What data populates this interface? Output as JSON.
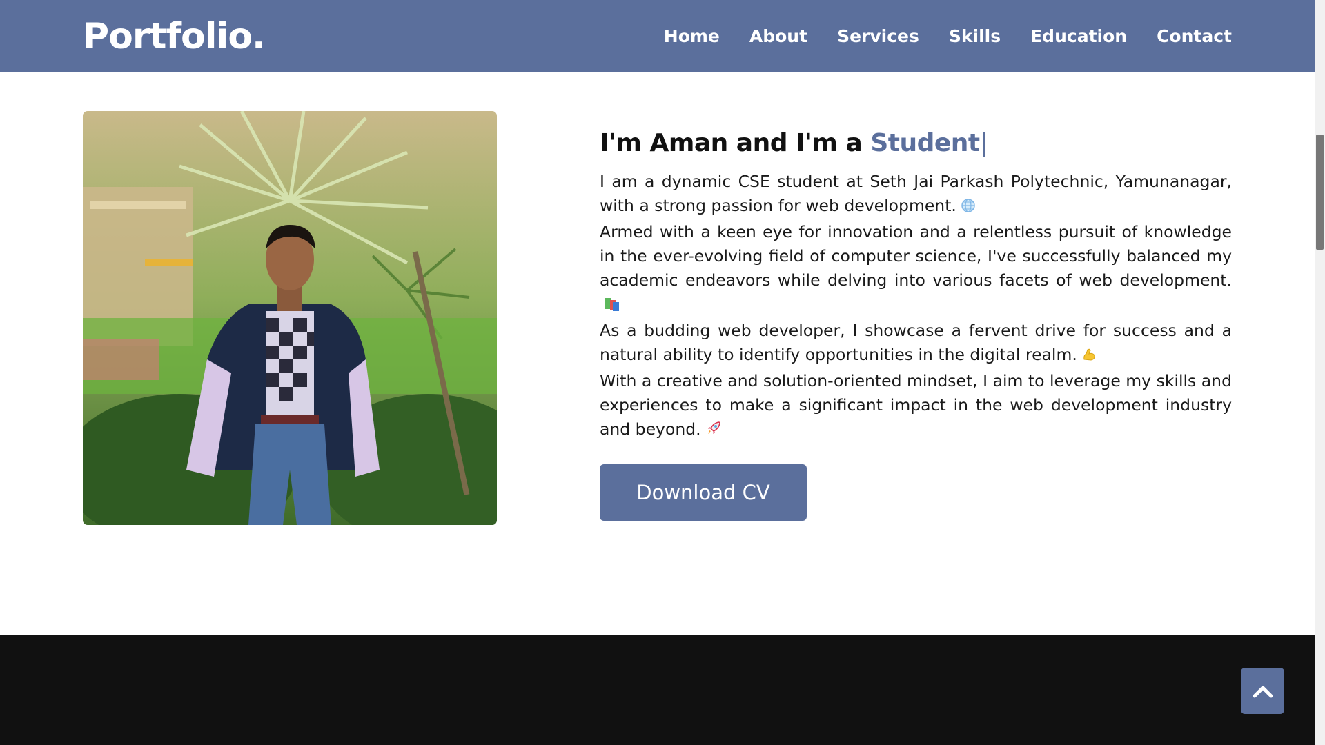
{
  "nav": {
    "logo": "Portfolio.",
    "items": [
      {
        "label": "Home"
      },
      {
        "label": "About"
      },
      {
        "label": "Services"
      },
      {
        "label": "Skills"
      },
      {
        "label": "Education"
      },
      {
        "label": "Contact"
      }
    ]
  },
  "about": {
    "heading_prefix": "I'm Aman and I'm a ",
    "heading_role": "Student",
    "heading_cursor": "|",
    "paragraphs": [
      {
        "text": "I am a dynamic CSE student at Seth Jai Parkash Polytechnic, Yamunanagar, with a strong passion for web development.",
        "emoji": "globe-emoji"
      },
      {
        "text": "Armed with a keen eye for innovation and a relentless pursuit of knowledge in the ever-evolving field of computer science, I've successfully balanced my academic endeavors while delving into various facets of web development.",
        "emoji": "books-emoji"
      },
      {
        "text": "As a budding web developer, I showcase a fervent drive for success and a natural ability to identify opportunities in the digital realm.",
        "emoji": "flexed-arm-emoji"
      },
      {
        "text": "With a creative and solution-oriented mindset, I aim to leverage my skills and experiences to make a significant impact in the web development industry and beyond.",
        "emoji": "rocket-emoji"
      }
    ],
    "cv_button": "Download CV"
  },
  "scroll_top_icon": "chevron-up-icon",
  "colors": {
    "accent": "#5b6f9c",
    "footer_bg": "#111111",
    "text": "#111111"
  }
}
